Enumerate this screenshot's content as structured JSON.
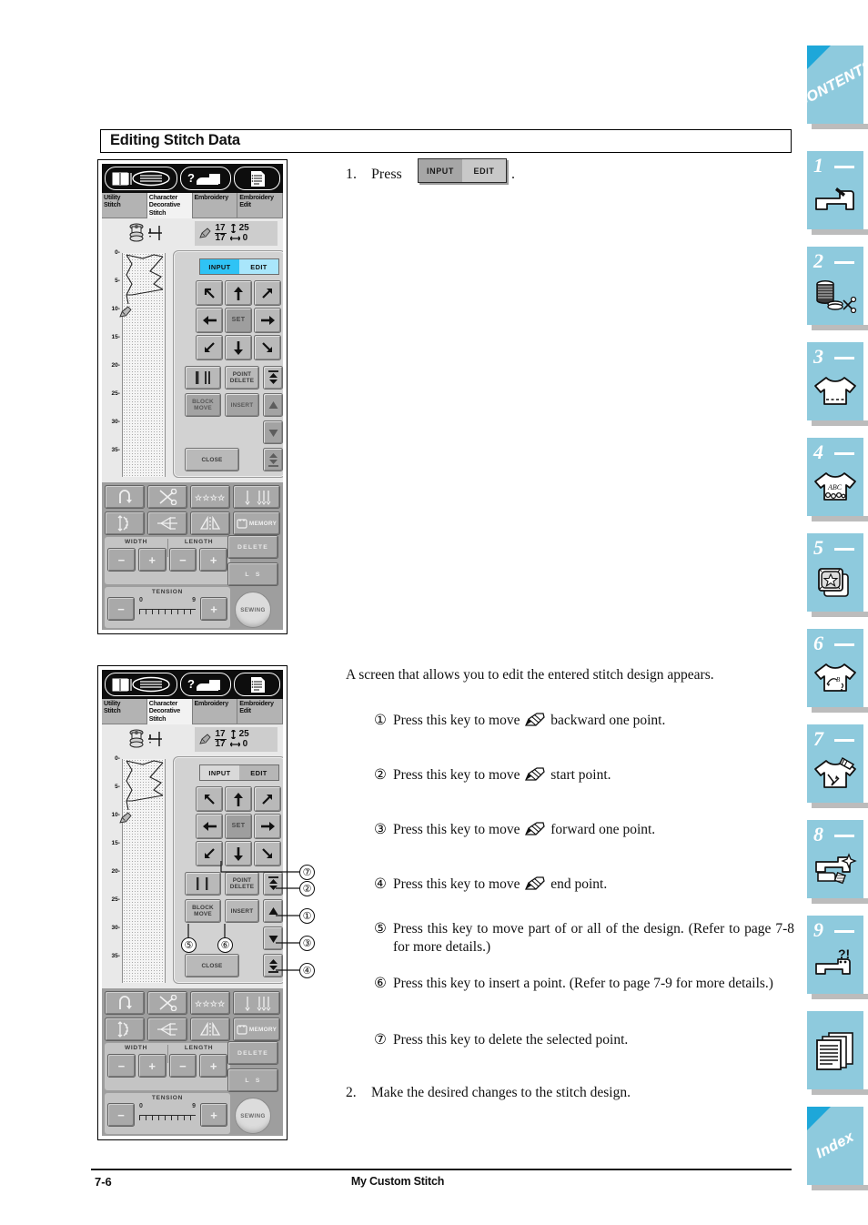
{
  "heading": "Editing Stitch Data",
  "step1": {
    "number": "1.",
    "verb": "Press",
    "period": ".",
    "toggle": {
      "input": "INPUT",
      "edit": "EDIT",
      "selected": "INPUT"
    }
  },
  "intro_paragraph": "A screen that allows you to edit the entered stitch design appears.",
  "bullets": [
    {
      "marker": "①",
      "text_before": "Press this key to move",
      "icon": "pencil-icon",
      "text_after": "backward one point."
    },
    {
      "marker": "②",
      "text_before": "Press this key to move",
      "icon": "pencil-icon",
      "text_after": "start point."
    },
    {
      "marker": "③",
      "text_before": "Press this key to move",
      "icon": "pencil-icon",
      "text_after": "forward one point."
    },
    {
      "marker": "④",
      "text_before": "Press this key to move",
      "icon": "pencil-icon",
      "text_after": "end point."
    },
    {
      "marker": "⑤",
      "text_before": "Press this key to move part of or all of the design. (Refer to page 7-8 for more details.)",
      "icon": null,
      "text_after": ""
    },
    {
      "marker": "⑥",
      "text_before": "Press this key to insert a point. (Refer to page 7-9 for more details.)",
      "icon": null,
      "text_after": ""
    },
    {
      "marker": "⑦",
      "text_before": "Press this key to delete the selected point.",
      "icon": null,
      "text_after": ""
    }
  ],
  "step2": {
    "number": "2.",
    "text": "Make the desired changes to the stitch design."
  },
  "lcd": {
    "top_icons": [
      "book-needle-icon",
      "question-machine-icon",
      "document-list-icon"
    ],
    "tabs": [
      {
        "label": "Utility\nStitch",
        "active": false
      },
      {
        "label": "Character\nDecorative\nStitch",
        "active": true
      },
      {
        "label": "Embroidery",
        "active": false
      },
      {
        "label": "Embroidery\nEdit",
        "active": false
      }
    ],
    "status": {
      "bobbin_icon": "bobbin-icon",
      "needle_icon": "needle-down-icon",
      "pencil_icon": "pencil-icon",
      "point_current": "17",
      "point_total": "17",
      "height_value": "25",
      "width_value": "0"
    },
    "ruler_ticks": [
      "0",
      "5",
      "10",
      "15",
      "20",
      "25",
      "30",
      "35"
    ],
    "toggle": {
      "input": "INPUT",
      "edit": "EDIT"
    },
    "screen1_selected": "INPUT",
    "screen2_selected": "EDIT",
    "dpad": [
      "arrow-up-left",
      "arrow-up",
      "arrow-up-right",
      "arrow-left",
      "SET",
      "arrow-right",
      "arrow-down-left",
      "arrow-down",
      "arrow-down-right"
    ],
    "set_label": "SET",
    "actions": {
      "single_double": "single-double-stitch-icon",
      "point_delete": "POINT\nDELETE",
      "block_move": "BLOCK\nMOVE",
      "insert": "INSERT",
      "close": "CLOSE",
      "jump_start": "jump-to-start-icon",
      "step_back": "step-back-icon",
      "step_forward": "step-forward-icon",
      "jump_end": "jump-to-end-icon"
    },
    "tools": {
      "reverse": "reverse-stitch-icon",
      "thread_cut": "scissors-icon",
      "stitch_select": "stitch-pattern-icon",
      "needle_mode": "needle-mode-icon",
      "elongation": "elongation-icon",
      "mirror_horizontal": "mirror-horizontal-icon",
      "mirror_vertical": "mirror-vertical-icon",
      "memory": "MEMORY",
      "width_label": "WIDTH",
      "length_label": "LENGTH",
      "minus": "−",
      "plus": "+",
      "tension_label": "TENSION",
      "tension_min": "0",
      "tension_max": "9",
      "delete": "DELETE",
      "l_label": "L",
      "s_label": "S",
      "sewing": "SEWING"
    }
  },
  "callouts": [
    "①",
    "②",
    "③",
    "④",
    "⑤",
    "⑥",
    "⑦"
  ],
  "sidebar": [
    {
      "id": "contents",
      "label": "CONTENTS",
      "number": null,
      "icon": null,
      "corner": true
    },
    {
      "id": "ch1",
      "label": null,
      "number": "1",
      "icon": "sewing-machine-icon",
      "corner": false
    },
    {
      "id": "ch2",
      "label": null,
      "number": "2",
      "icon": "spool-scissors-icon",
      "corner": false
    },
    {
      "id": "ch3",
      "label": null,
      "number": "3",
      "icon": "tshirt-stitch-icon",
      "corner": false
    },
    {
      "id": "ch4",
      "label": null,
      "number": "4",
      "icon": "tshirt-abc-icon",
      "corner": false
    },
    {
      "id": "ch5",
      "label": null,
      "number": "5",
      "icon": "hoop-star-icon",
      "corner": false
    },
    {
      "id": "ch6",
      "label": null,
      "number": "6",
      "icon": "tshirt-embroidery-icon",
      "corner": false
    },
    {
      "id": "ch7",
      "label": null,
      "number": "7",
      "icon": "tshirt-pencil-icon",
      "corner": false
    },
    {
      "id": "ch8",
      "label": null,
      "number": "8",
      "icon": "machine-sparkle-icon",
      "corner": false
    },
    {
      "id": "ch9",
      "label": null,
      "number": "9",
      "icon": "machine-question-icon",
      "corner": false
    },
    {
      "id": "appendix",
      "label": null,
      "number": null,
      "icon": "pages-icon",
      "corner": false
    },
    {
      "id": "index",
      "label": "Index",
      "number": null,
      "icon": null,
      "corner": true
    }
  ],
  "footer": {
    "page": "7-6",
    "title": "My Custom Stitch"
  },
  "colors": {
    "sidebar_bg": "#8ecadd",
    "sidebar_corner": "#1ea7d9",
    "lcd_bg": "#e9e9e9",
    "highlight_cyan": "#2fc3f5"
  }
}
